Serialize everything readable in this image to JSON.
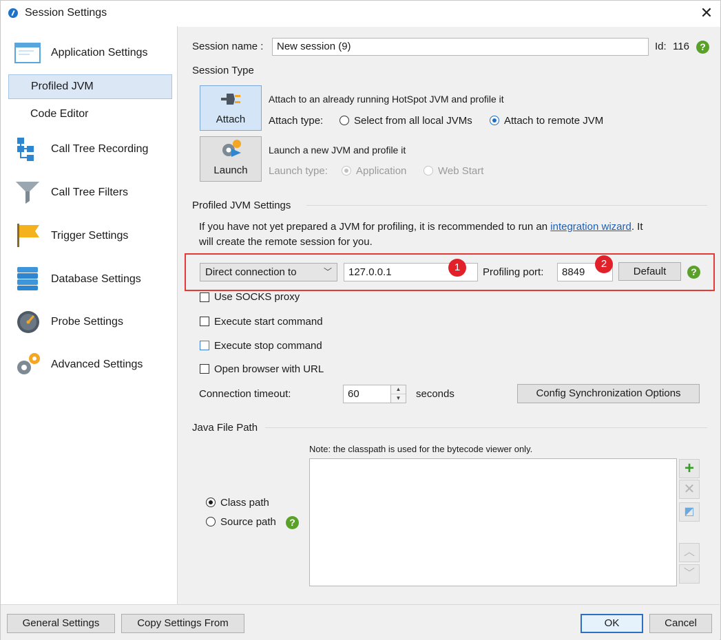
{
  "window": {
    "title": "Session Settings",
    "close_label": "✕"
  },
  "sidebar": {
    "items": [
      {
        "label": "Application Settings",
        "icon": "window-icon"
      },
      {
        "label": "Profiled JVM",
        "selected": true
      },
      {
        "label": "Code Editor"
      },
      {
        "label": "Call Tree Recording",
        "icon": "tree-icon"
      },
      {
        "label": "Call Tree Filters",
        "icon": "funnel-icon"
      },
      {
        "label": "Trigger Settings",
        "icon": "flag-icon"
      },
      {
        "label": "Database Settings",
        "icon": "database-icon"
      },
      {
        "label": "Probe Settings",
        "icon": "gauge-icon"
      },
      {
        "label": "Advanced Settings",
        "icon": "gears-icon"
      }
    ]
  },
  "session": {
    "name_label": "Session name :",
    "name_value": "New session (9)",
    "id_label": "Id:",
    "id_value": "116"
  },
  "session_type": {
    "heading": "Session Type",
    "attach": {
      "button_label": "Attach",
      "description": "Attach to an already running HotSpot JVM and profile it",
      "type_label": "Attach type:",
      "option_local": "Select from all local JVMs",
      "option_remote": "Attach to remote JVM",
      "selected": "remote"
    },
    "launch": {
      "button_label": "Launch",
      "description": "Launch a new JVM and profile it",
      "type_label": "Launch type:",
      "option_app": "Application",
      "option_web": "Web Start"
    }
  },
  "profiled_jvm": {
    "heading": "Profiled JVM Settings",
    "info_before": "If you have not yet prepared a JVM for profiling, it is recommended to run an ",
    "info_link": "integration wizard",
    "info_after": ". It",
    "info_line2": "will create the remote session for you.",
    "connection_mode": "Direct connection to",
    "host": "127.0.0.1",
    "port_label": "Profiling port:",
    "port": "8849",
    "default_button": "Default",
    "badge1": "1",
    "badge2": "2"
  },
  "options": {
    "socks": "Use SOCKS proxy",
    "start_cmd": "Execute start command",
    "stop_cmd": "Execute stop command",
    "open_browser": "Open browser with URL",
    "timeout_label": "Connection timeout:",
    "timeout_value": "60",
    "timeout_unit": "seconds",
    "sync_button": "Config Synchronization Options"
  },
  "java_path": {
    "heading": "Java File Path",
    "note": "Note: the classpath is used for the bytecode viewer only.",
    "class_path": "Class path",
    "source_path": "Source path"
  },
  "footer": {
    "general": "General Settings",
    "copy": "Copy Settings From",
    "ok": "OK",
    "cancel": "Cancel"
  },
  "colors": {
    "accent": "#2b6fc7",
    "help": "#5aa12a",
    "badge": "#e2202a",
    "highlight_box": "#e53935"
  }
}
